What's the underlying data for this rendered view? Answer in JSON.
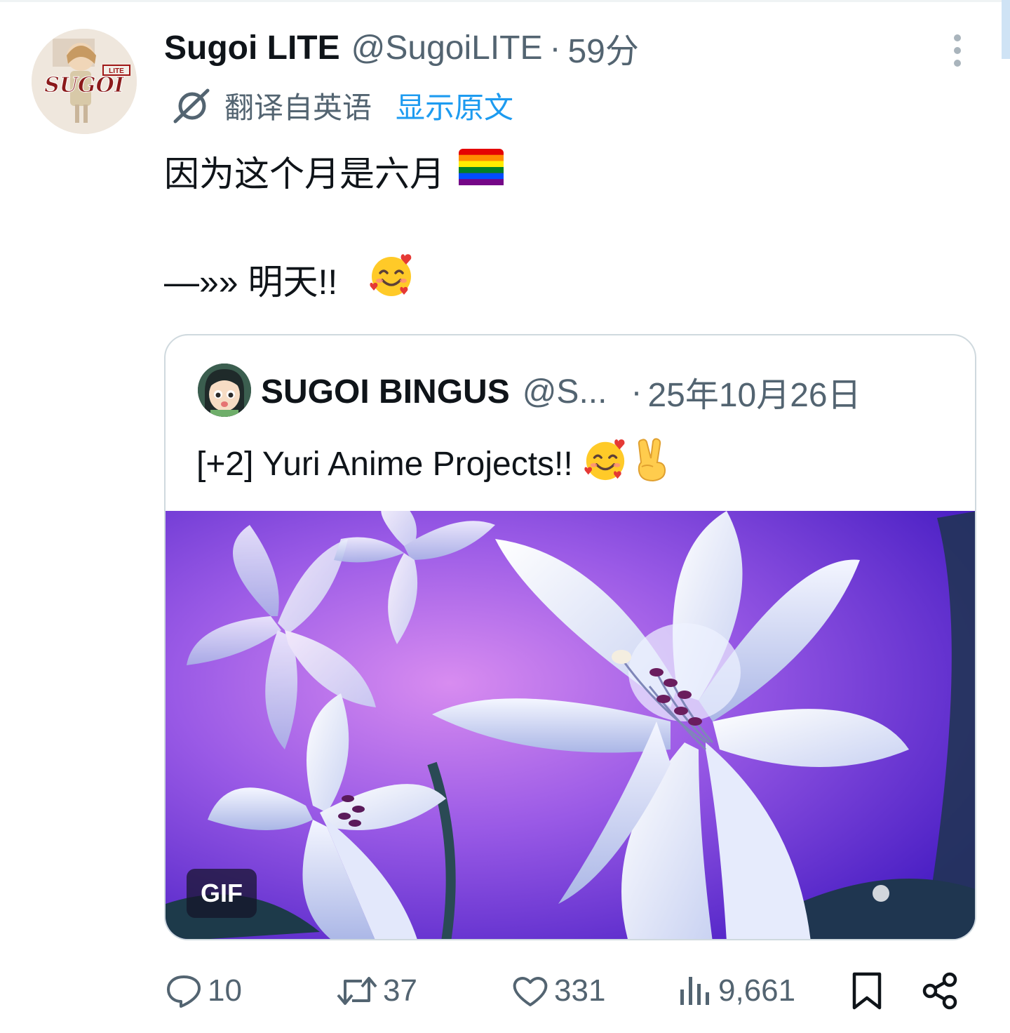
{
  "tweet": {
    "display_name": "Sugoi LITE",
    "handle": "@SugoiLITE",
    "separator": "·",
    "time": "59分",
    "avatar_text": "SUGOI",
    "avatar_badge": "LITE",
    "translated_label": "翻译自英语",
    "show_original": "显示原文",
    "line1": "因为这个月是六月",
    "line2": "—»» 明天!!",
    "line1_emoji": "rainbow-flag-icon",
    "line2_emoji": "smiling-face-with-hearts-icon"
  },
  "quote": {
    "display_name": "SUGOI BINGUS",
    "handle": "@S...",
    "separator": "·",
    "date": "25年10月26日",
    "text": "[+2] Yuri Anime Projects!!",
    "emojis": [
      "smiling-face-with-hearts-icon",
      "victory-hand-icon"
    ],
    "media_badge": "GIF",
    "media": "white-lily-flowers-on-purple-background"
  },
  "actions": {
    "replies": "10",
    "retweets": "37",
    "likes": "331",
    "views": "9,661"
  },
  "colors": {
    "text": "#0f1419",
    "secondary": "#536471",
    "link": "#1d9bf0",
    "border": "#cfd9de"
  }
}
